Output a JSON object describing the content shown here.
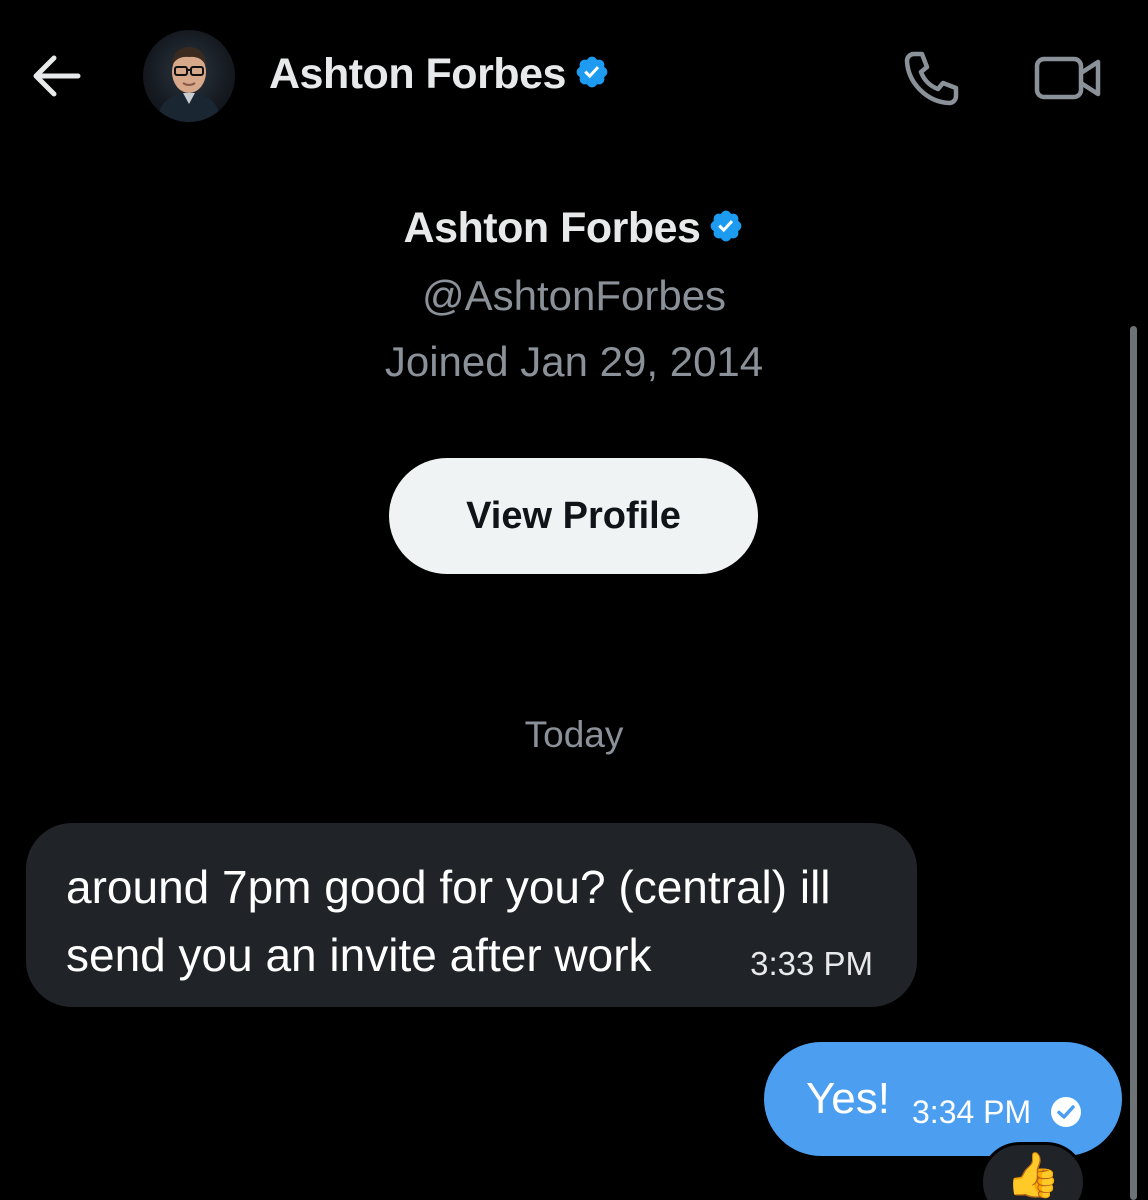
{
  "header": {
    "name": "Ashton Forbes"
  },
  "profile": {
    "name": "Ashton Forbes",
    "handle": "@AshtonForbes",
    "joined": "Joined Jan 29, 2014",
    "view_profile_label": "View Profile"
  },
  "conversation": {
    "date_separator": "Today",
    "messages": [
      {
        "direction": "incoming",
        "text": "around 7pm good for you? (central) ill send you an invite after work",
        "time": "3:33 PM"
      },
      {
        "direction": "outgoing",
        "text": "Yes!",
        "time": "3:34 PM",
        "status_icon": "read-check-icon",
        "reaction": "👍"
      }
    ]
  },
  "icons": {
    "back": "arrow-left-icon",
    "verified": "verified-badge-icon",
    "call": "phone-icon",
    "video": "video-camera-icon"
  },
  "colors": {
    "background": "#000000",
    "verified_blue": "#1d9bf0",
    "outgoing_bubble": "#4c9ef0",
    "incoming_bubble": "#202327",
    "secondary_text": "#8b9199",
    "button_bg": "#eff3f4"
  }
}
